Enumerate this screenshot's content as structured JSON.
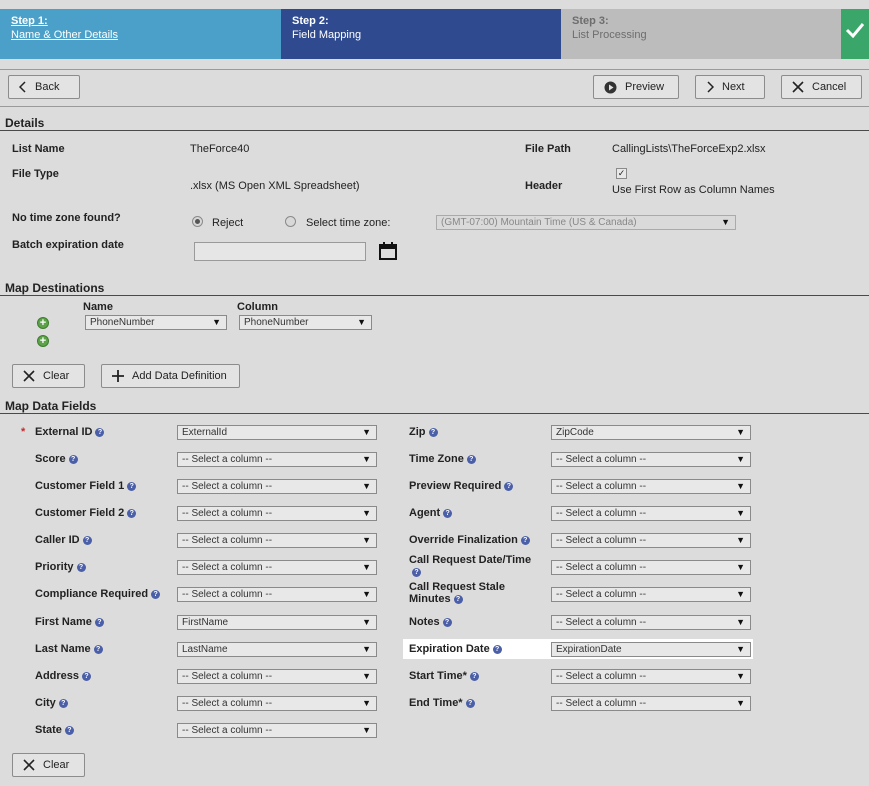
{
  "wizard": {
    "step1": {
      "title": "Step 1:",
      "name": "Name & Other Details"
    },
    "step2": {
      "title": "Step 2:",
      "name": "Field Mapping"
    },
    "step3": {
      "title": "Step 3:",
      "name": "List Processing"
    }
  },
  "toolbar": {
    "back": "Back",
    "preview": "Preview",
    "next": "Next",
    "cancel": "Cancel"
  },
  "details": {
    "heading": "Details",
    "list_name_label": "List Name",
    "list_name": "TheForce40",
    "file_path_label": "File Path",
    "file_path": "CallingLists\\TheForceExp2.xlsx",
    "file_type_label": "File Type",
    "file_type": ".xlsx (MS Open XML Spreadsheet)",
    "header_label": "Header",
    "header_checked": true,
    "header_text": "Use First Row as Column Names",
    "timezone_label": "No time zone found?",
    "reject_label": "Reject",
    "select_tz_label": "Select time zone:",
    "timezone_value": "(GMT-07:00) Mountain Time (US & Canada)",
    "batch_label": "Batch expiration date",
    "batch_value": ""
  },
  "destinations": {
    "heading": "Map Destinations",
    "name_header": "Name",
    "column_header": "Column",
    "name_value": "PhoneNumber",
    "column_value": "PhoneNumber",
    "clear": "Clear",
    "add": "Add Data Definition"
  },
  "fields": {
    "heading": "Map Data Fields",
    "left": [
      {
        "label": "External ID",
        "value": "ExternalId",
        "required": true
      },
      {
        "label": "Score",
        "value": "-- Select a column --"
      },
      {
        "label": "Customer Field 1",
        "value": "-- Select a column --"
      },
      {
        "label": "Customer Field 2",
        "value": "-- Select a column --"
      },
      {
        "label": "Caller ID",
        "value": "-- Select a column --"
      },
      {
        "label": "Priority",
        "value": "-- Select a column --"
      },
      {
        "label": "Compliance Required",
        "value": "-- Select a column --"
      },
      {
        "label": "First Name",
        "value": "FirstName"
      },
      {
        "label": "Last Name",
        "value": "LastName"
      },
      {
        "label": "Address",
        "value": "-- Select a column --"
      },
      {
        "label": "City",
        "value": "-- Select a column --"
      },
      {
        "label": "State",
        "value": "-- Select a column --"
      }
    ],
    "right": [
      {
        "label": "Zip",
        "value": "ZipCode"
      },
      {
        "label": "Time Zone",
        "value": "-- Select a column --"
      },
      {
        "label": "Preview Required",
        "value": "-- Select a column --"
      },
      {
        "label": "Agent",
        "value": "-- Select a column --"
      },
      {
        "label": "Override Finalization",
        "value": "-- Select a column --"
      },
      {
        "label": "Call Request Date/Time",
        "value": "-- Select a column --"
      },
      {
        "label": "Call Request Stale Minutes",
        "value": "-- Select a column --"
      },
      {
        "label": "Notes",
        "value": "-- Select a column --"
      },
      {
        "label": "Expiration Date",
        "value": "ExpirationDate"
      },
      {
        "label": "Start Time*",
        "value": "-- Select a column --"
      },
      {
        "label": "End Time*",
        "value": "-- Select a column --"
      }
    ],
    "clear": "Clear"
  },
  "colors": {
    "step1": "#4aa0c8",
    "step2": "#2f4a8f",
    "step3": "#bcbcbc",
    "done": "#3aa66a",
    "help": "#4b5fa8"
  }
}
